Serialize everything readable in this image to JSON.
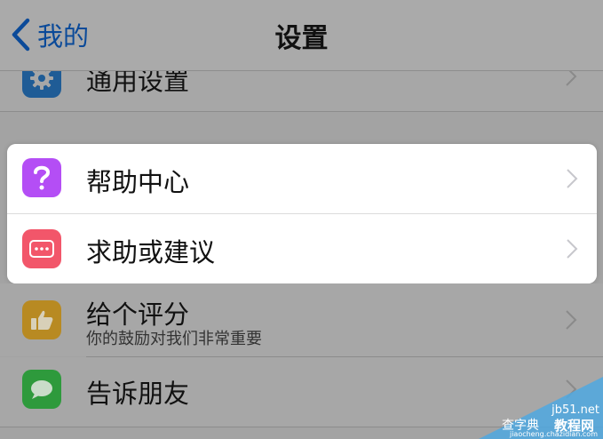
{
  "nav": {
    "back_label": "我的",
    "title": "设置"
  },
  "rows": {
    "general": {
      "label": "通用设置"
    },
    "help_center": {
      "label": "帮助中心"
    },
    "feedback": {
      "label": "求助或建议"
    },
    "rate": {
      "label": "给个评分",
      "sublabel": "你的鼓励对我们非常重要"
    },
    "share": {
      "label": "告诉朋友"
    }
  },
  "icons": {
    "general": "gear-icon",
    "help_center": "question-mark-icon",
    "feedback": "chat-bubble-ellipsis-icon",
    "rate": "thumbs-up-icon",
    "share": "message-bubble-icon",
    "chevron": "chevron-right-icon",
    "back": "chevron-left-icon"
  },
  "colors": {
    "accent": "#0b4a99",
    "general_icon": "#1f5c96",
    "help_center_icon": "#b44ef5",
    "feedback_icon": "#f2566a",
    "rate_icon": "#b88a22",
    "share_icon": "#2e9a3c"
  },
  "watermark": {
    "site": "jb51.net",
    "name": "教程网",
    "prefix": "查字典",
    "url": "jiaocheng.chazidian.com"
  }
}
